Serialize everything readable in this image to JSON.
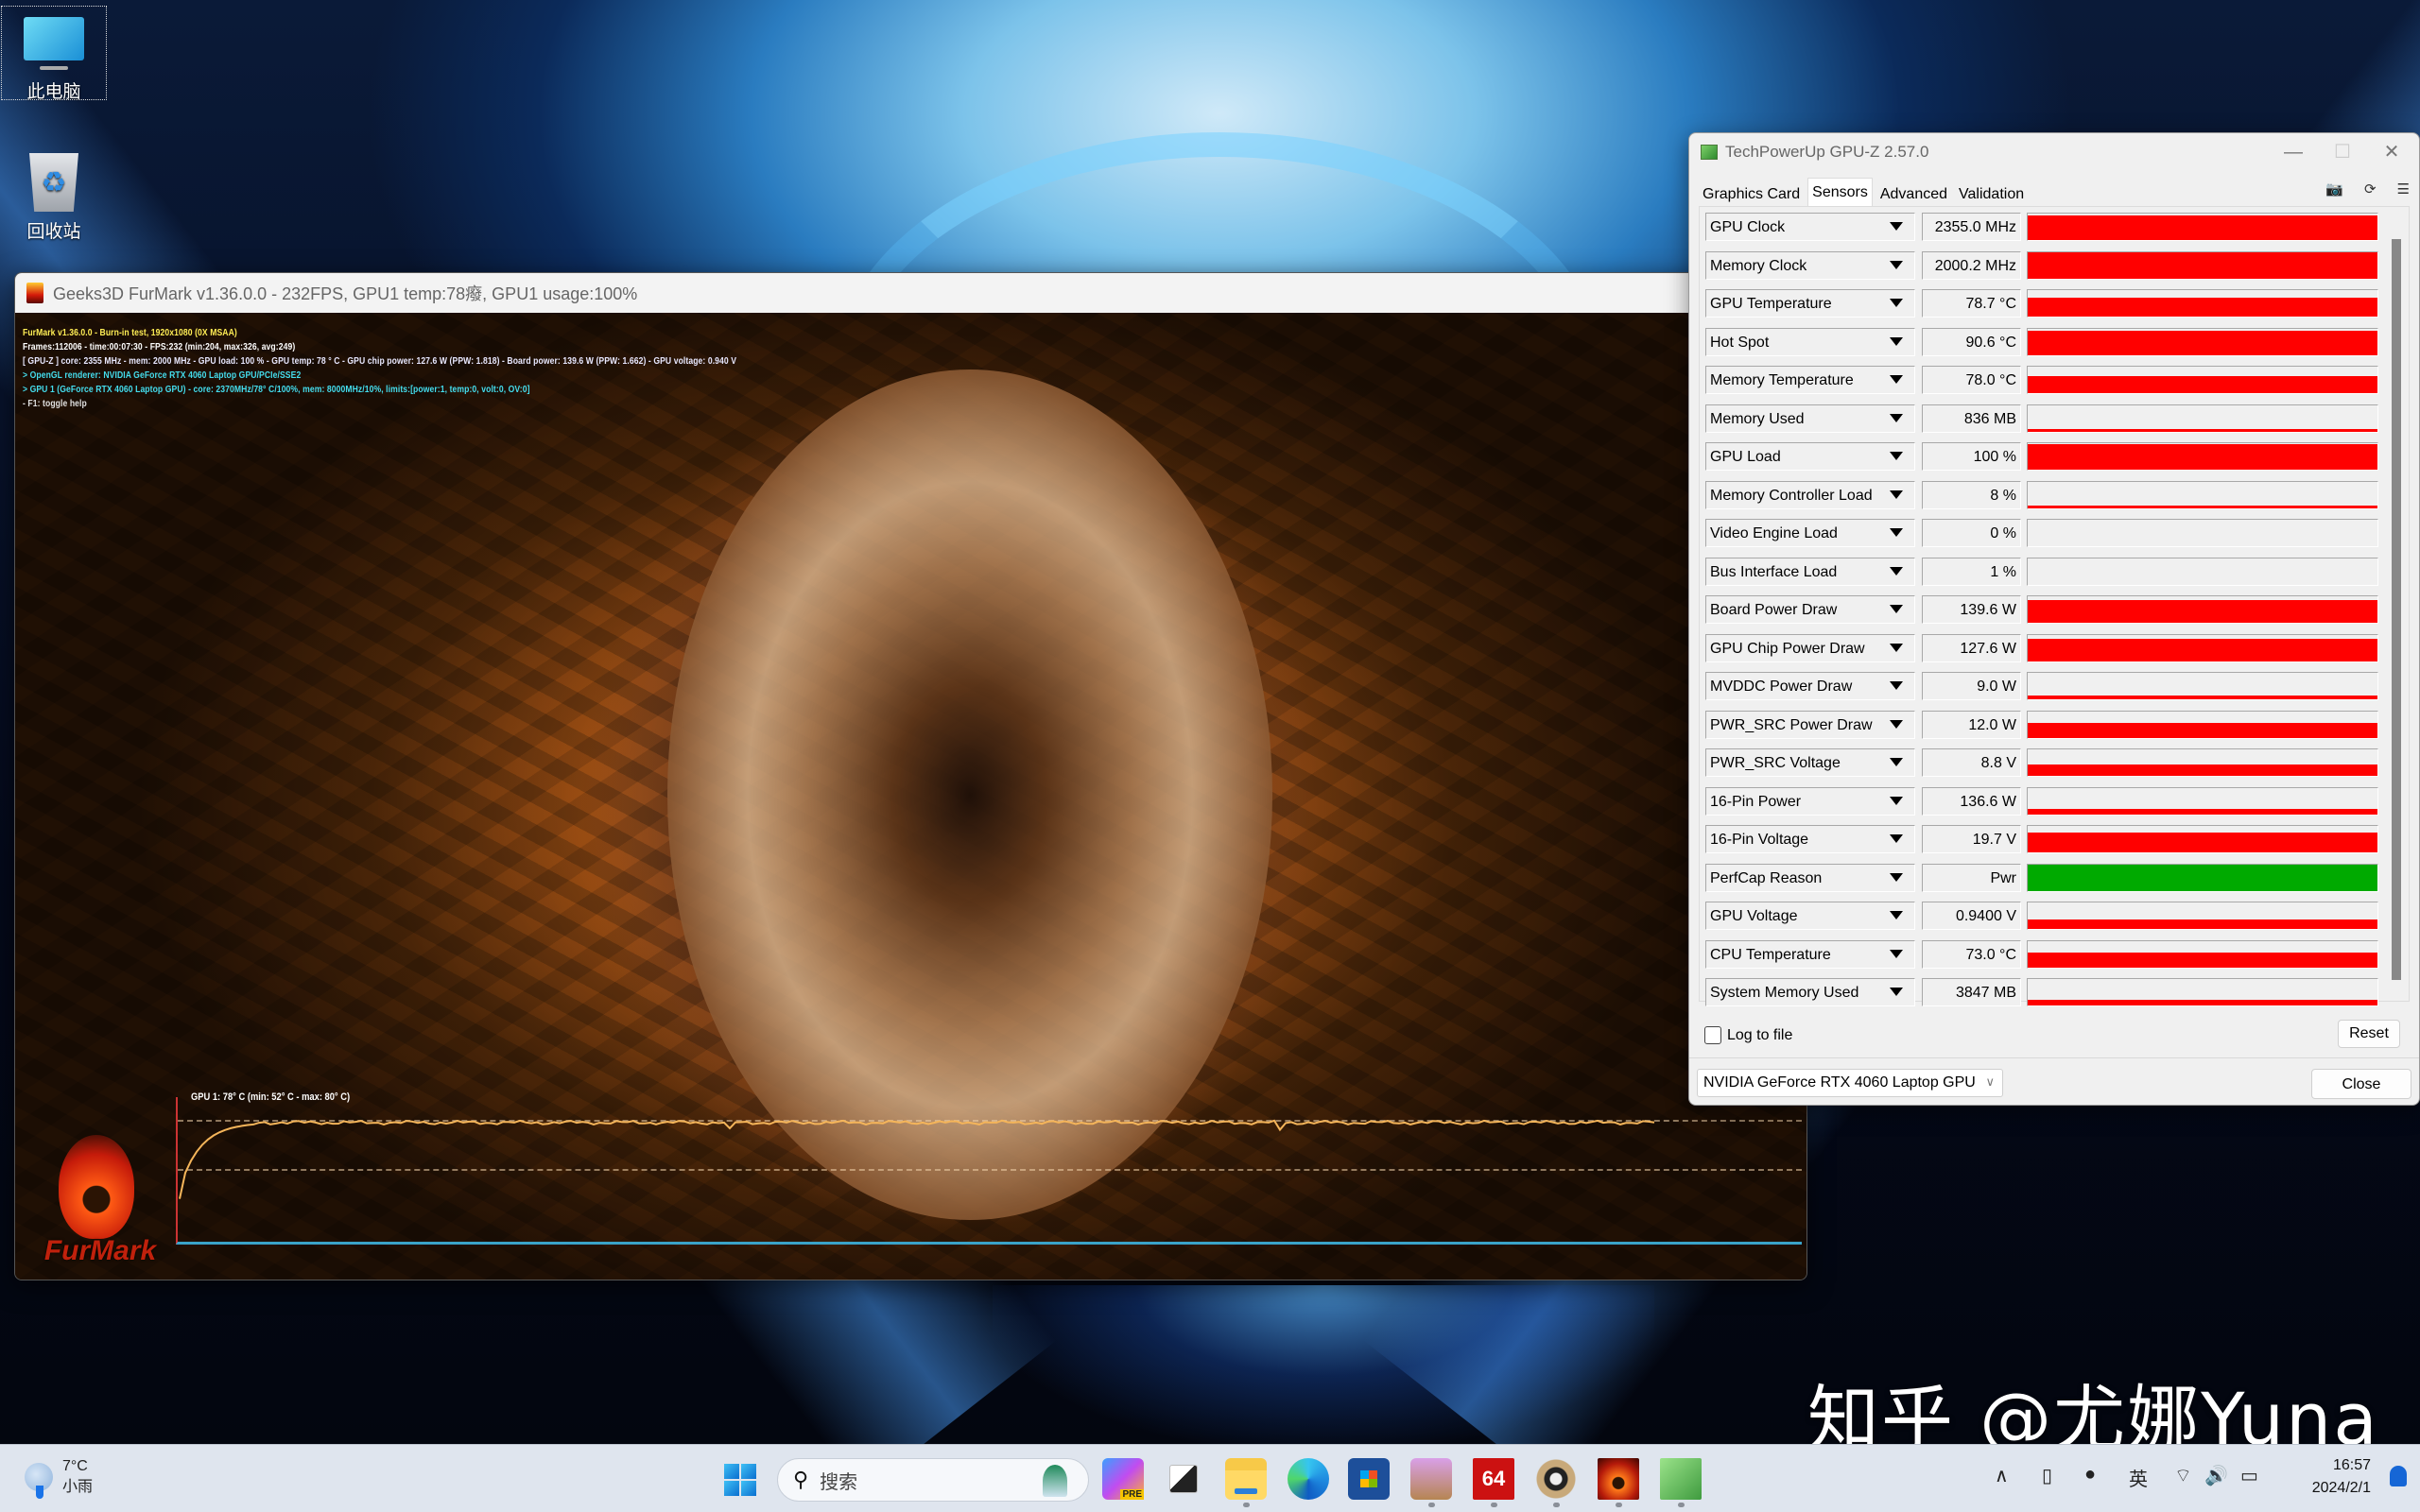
{
  "desktop": {
    "icons": [
      {
        "label": "此电脑",
        "icon": "computer-icon"
      },
      {
        "label": "回收站",
        "icon": "recycle-bin-icon"
      }
    ],
    "watermark": "知乎 @尤娜Yuna"
  },
  "furmark": {
    "title": "Geeks3D FurMark v1.36.0.0 - 232FPS, GPU1 temp:78癈, GPU1 usage:100%",
    "osd": [
      "FurMark v1.36.0.0 - Burn-in test, 1920x1080 (0X MSAA)",
      "Frames:112006 - time:00:07:30 - FPS:232 (min:204, max:326, avg:249)",
      "[ GPU-Z ] core: 2355 MHz - mem: 2000 MHz - GPU load: 100 % - GPU temp: 78 ° C - GPU chip power: 127.6 W (PPW: 1.818) - Board power: 139.6 W (PPW: 1.662) - GPU voltage: 0.940 V",
      "> OpenGL renderer: NVIDIA GeForce RTX 4060 Laptop GPU/PCIe/SSE2",
      "> GPU 1 (GeForce RTX 4060 Laptop GPU) - core: 2370MHz/78° C/100%, mem: 8000MHz/10%, limits:[power:1, temp:0, volt:0, OV:0]",
      "- F1: toggle help"
    ],
    "temp_graph": {
      "label": "GPU 1: 78° C (min: 52° C - max: 80° C)",
      "current_c": 78,
      "min_c": 52,
      "max_c": 80
    },
    "logo_text": "FurMark"
  },
  "gpuz": {
    "title": "TechPowerUp GPU-Z 2.57.0",
    "tabs": [
      "Graphics Card",
      "Sensors",
      "Advanced",
      "Validation"
    ],
    "active_tab": "Sensors",
    "sensors": [
      {
        "name": "GPU Clock",
        "value": "2355.0 MHz",
        "level": 0.93,
        "color": "#ff0000"
      },
      {
        "name": "Memory Clock",
        "value": "2000.2 MHz",
        "level": 1.0,
        "color": "#ff0000"
      },
      {
        "name": "GPU Temperature",
        "value": "78.7 °C",
        "level": 0.72,
        "color": "#ff0000"
      },
      {
        "name": "Hot Spot",
        "value": "90.6 °C",
        "level": 0.9,
        "color": "#ff0000"
      },
      {
        "name": "Memory Temperature",
        "value": "78.0 °C",
        "level": 0.65,
        "color": "#ff0000"
      },
      {
        "name": "Memory Used",
        "value": "836 MB",
        "level": 0.08,
        "color": "#ff0000"
      },
      {
        "name": "GPU Load",
        "value": "100 %",
        "level": 0.95,
        "color": "#ff0000"
      },
      {
        "name": "Memory Controller Load",
        "value": "8 %",
        "level": 0.08,
        "color": "#ff0000"
      },
      {
        "name": "Video Engine Load",
        "value": "0 %",
        "level": 0.0,
        "color": "#ff0000"
      },
      {
        "name": "Bus Interface Load",
        "value": "1 %",
        "level": 0.0,
        "color": "#ff0000"
      },
      {
        "name": "Board Power Draw",
        "value": "139.6 W",
        "level": 0.85,
        "color": "#ff0000"
      },
      {
        "name": "GPU Chip Power Draw",
        "value": "127.6 W",
        "level": 0.85,
        "color": "#ff0000"
      },
      {
        "name": "MVDDC Power Draw",
        "value": "9.0 W",
        "level": 0.15,
        "color": "#ff0000"
      },
      {
        "name": "PWR_SRC Power Draw",
        "value": "12.0 W",
        "level": 0.55,
        "color": "#ff0000"
      },
      {
        "name": "PWR_SRC Voltage",
        "value": "8.8 V",
        "level": 0.42,
        "color": "#ff0000"
      },
      {
        "name": "16-Pin Power",
        "value": "136.6 W",
        "level": 0.2,
        "color": "#ff0000"
      },
      {
        "name": "16-Pin Voltage",
        "value": "19.7 V",
        "level": 0.75,
        "color": "#ff0000"
      },
      {
        "name": "PerfCap Reason",
        "value": "Pwr",
        "level": 1.0,
        "color": "#00aa00"
      },
      {
        "name": "GPU Voltage",
        "value": "0.9400 V",
        "level": 0.35,
        "color": "#ff0000"
      },
      {
        "name": "CPU Temperature",
        "value": "73.0 °C",
        "level": 0.55,
        "color": "#ff0000"
      },
      {
        "name": "System Memory Used",
        "value": "3847 MB",
        "level": 0.22,
        "color": "#ff0000"
      }
    ],
    "log_to_file": {
      "label": "Log to file",
      "checked": false
    },
    "reset_label": "Reset",
    "close_label": "Close",
    "gpu_select": "NVIDIA GeForce RTX 4060 Laptop GPU"
  },
  "taskbar": {
    "weather": {
      "temp": "7°C",
      "desc": "小雨"
    },
    "search_placeholder": "搜索",
    "apps": [
      {
        "name": "copilot",
        "label": "PRE"
      },
      {
        "name": "task-view",
        "label": ""
      },
      {
        "name": "file-explorer",
        "label": ""
      },
      {
        "name": "edge",
        "label": ""
      },
      {
        "name": "store",
        "label": ""
      },
      {
        "name": "package-app",
        "label": ""
      },
      {
        "name": "aida64",
        "label": "64"
      },
      {
        "name": "app-circle",
        "label": ""
      },
      {
        "name": "furmark",
        "label": ""
      },
      {
        "name": "gpu-z",
        "label": ""
      }
    ],
    "tray": {
      "ime": "英"
    },
    "clock": {
      "time": "16:57",
      "date": "2024/2/1"
    }
  }
}
